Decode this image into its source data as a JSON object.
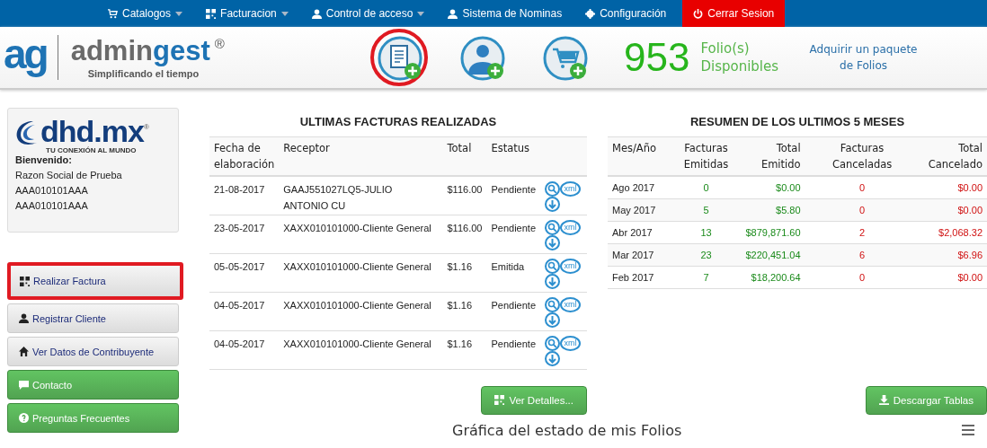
{
  "nav": [
    {
      "label": "Catalogos",
      "dropdown": true,
      "kind": "normal"
    },
    {
      "label": "Facturacion",
      "dropdown": true,
      "kind": "normal"
    },
    {
      "label": "Control de acceso",
      "dropdown": true,
      "kind": "normal"
    },
    {
      "label": "Sistema de Nominas",
      "dropdown": false,
      "kind": "normal"
    },
    {
      "label": "Configuración",
      "dropdown": false,
      "kind": "normal"
    },
    {
      "label": "Cerrar Sesion",
      "dropdown": false,
      "kind": "logout"
    }
  ],
  "header": {
    "logo": {
      "mark": "ag",
      "name_a": "admin",
      "name_b": "gest",
      "reg": "®",
      "tagline": "Simplificando el tiempo"
    },
    "actions": [
      {
        "highlighted": true
      },
      {
        "highlighted": false
      },
      {
        "highlighted": false
      }
    ],
    "folios": {
      "count": "953",
      "label_1": "Folio(s)",
      "label_2": "Disponibles"
    },
    "buy_link": "Adquirir un paquete de Folios"
  },
  "sidebar": {
    "company": {
      "name": "dhd.mx",
      "reg": "®",
      "slogan": "TU CONEXIÓN AL MUNDO"
    },
    "welcome": "Bienvenido:",
    "lines": [
      "Razon Social de Prueba",
      "AAA010101AAA",
      "AAA010101AAA"
    ],
    "buttons": [
      {
        "label": "Realizar Factura",
        "kind": "default",
        "highlighted": true
      },
      {
        "label": "Registrar Cliente",
        "kind": "default",
        "highlighted": false
      },
      {
        "label": "Ver Datos de Contribuyente",
        "kind": "default",
        "highlighted": false
      },
      {
        "label": "Contacto",
        "kind": "success",
        "highlighted": false
      },
      {
        "label": "Preguntas Frecuentes",
        "kind": "success",
        "highlighted": false
      }
    ]
  },
  "invoices": {
    "title": "ULTIMAS FACTURAS REALIZADAS",
    "columns": [
      "Fecha de elaboración",
      "Receptor",
      "Total",
      "Estatus"
    ],
    "rows": [
      {
        "date": "21-08-2017",
        "receiver": "GAAJ551027LQ5-JULIO ANTONIO CU",
        "total": "$116.00",
        "status": "Pendiente",
        "xml_label": "xml"
      },
      {
        "date": "23-05-2017",
        "receiver": "XAXX010101000-Cliente General",
        "total": "$116.00",
        "status": "Pendiente",
        "xml_label": "xml"
      },
      {
        "date": "05-05-2017",
        "receiver": "XAXX010101000-Cliente General",
        "total": "$1.16",
        "status": "Emitida",
        "xml_label": "xml"
      },
      {
        "date": "04-05-2017",
        "receiver": "XAXX010101000-Cliente General",
        "total": "$1.16",
        "status": "Pendiente",
        "xml_label": "xml"
      },
      {
        "date": "04-05-2017",
        "receiver": "XAXX010101000-Cliente General",
        "total": "$1.16",
        "status": "Pendiente",
        "xml_label": "xml"
      }
    ],
    "button": "Ver Detalles..."
  },
  "summary": {
    "title": "RESUMEN DE LOS ULTIMOS 5 MESES",
    "columns": [
      "Mes/Año",
      "Facturas Emitidas",
      "Total Emitido",
      "Facturas Canceladas",
      "Total Cancelado"
    ],
    "rows": [
      [
        "Ago 2017",
        "0",
        "$0.00",
        "0",
        "$0.00"
      ],
      [
        "May 2017",
        "5",
        "$5.80",
        "0",
        "$0.00"
      ],
      [
        "Abr 2017",
        "13",
        "$879,871.60",
        "2",
        "$2,068.32"
      ],
      [
        "Mar 2017",
        "23",
        "$220,451.04",
        "6",
        "$6.96"
      ],
      [
        "Feb 2017",
        "7",
        "$18,200.64",
        "0",
        "$0.00"
      ]
    ],
    "button": "Descargar Tablas"
  },
  "chart": {
    "title": "Gráfica del estado de mis Folios"
  }
}
